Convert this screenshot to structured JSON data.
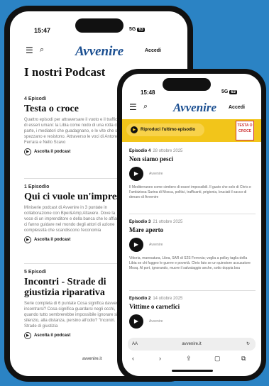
{
  "back_phone": {
    "status": {
      "time": "15:47",
      "signal": "5G",
      "battery": "63"
    },
    "header": {
      "menu_icon": "☰",
      "search_icon": "⌕",
      "logo": "Avvenire",
      "login": "Accedi"
    },
    "page_title": "I nostri Podcast",
    "podcasts": [
      {
        "episodes": "4 Episodi",
        "title": "Testa o croce",
        "description": "Quattro episodi per attraversare il vuoto e il traffico di esseri umani: la Libia come nodo di una rotta che parte, i mediatori che guadagnano, e le vite che si spezzano e resistono. Attraverso le voci di Antonella Ferrara e Nello Scavo",
        "listen": "Ascolta il podcast"
      },
      {
        "episodes": "1 Episodio",
        "title": "Qui ci vuole un'impresa",
        "description": "Miniserie podcast di Avvenire in 3 puntate in collaborazione con Bper&Amp;Altavere. Dove la voce di un imprenditore e della banca che lo affianca ci fanno guidare nel mondo degli attori di azione complessità che scandiscono l'economia",
        "listen": "Ascolta il podcast"
      },
      {
        "episodes": "5 Episodi",
        "title": "Incontri - Strade di giustizia riparativa",
        "description": "Serie completa di 6 puntate Cosa significa davvero incontrarsi? Cosa significa guardarsi negli occhi, quando tutto sembrerebbe impossibile ignorare si silenzio, alla distanza, persino all'odio? \"Incontri. Strade di giustizia",
        "listen": "Ascolta il podcast"
      }
    ],
    "url": "avvenire.it"
  },
  "front_phone": {
    "status": {
      "time": "15:48",
      "signal": "5G",
      "battery": "63"
    },
    "header": {
      "menu_icon": "☰",
      "search_icon": "⌕",
      "logo": "Avvenire",
      "login": "Accedi"
    },
    "banner": {
      "play_button": "Riproduci l'ultimo episodio",
      "cover_text": "TESTA O CROCE"
    },
    "episodes": [
      {
        "number": "Episodio 4",
        "date": "28 ottobre 2025",
        "title": "Non siamo pesci",
        "podcast": "Avvenire",
        "description": "Il Mediterraneo come cimitero di esseri impossibili. Il gusto che solo di Chris e l'ambiziosa Sarina di Mosca, politici, trafficanti, prigionia, bruciati il sacco di denaro di Avvenire"
      },
      {
        "number": "Episodio 3",
        "date": "21 ottobre 2025",
        "title": "Mare aperto",
        "podcast": "Avvenire",
        "description": "Vittoria, maresatura, Libra, SAR di S2S Ferrovia; voglia a pollay taglia della Libia se chi fuggeo le guerre e povertà. Chris fato se un quinotore accusatore Mosq. Al port, ignorando, muore il salvataggio anche, sotto doppia bou"
      },
      {
        "number": "Episodio 2",
        "date": "14 ottobre 2025",
        "title": "Vittime o carnefici",
        "podcast": "Avvenire",
        "description": ""
      }
    ],
    "url_bar": {
      "text_size": "AA",
      "url": "avvenire.it",
      "reload": "↻"
    },
    "toolbar": {
      "back": "‹",
      "forward": "›",
      "share": "⇪",
      "bookmarks": "▢",
      "tabs": "⧉"
    }
  }
}
